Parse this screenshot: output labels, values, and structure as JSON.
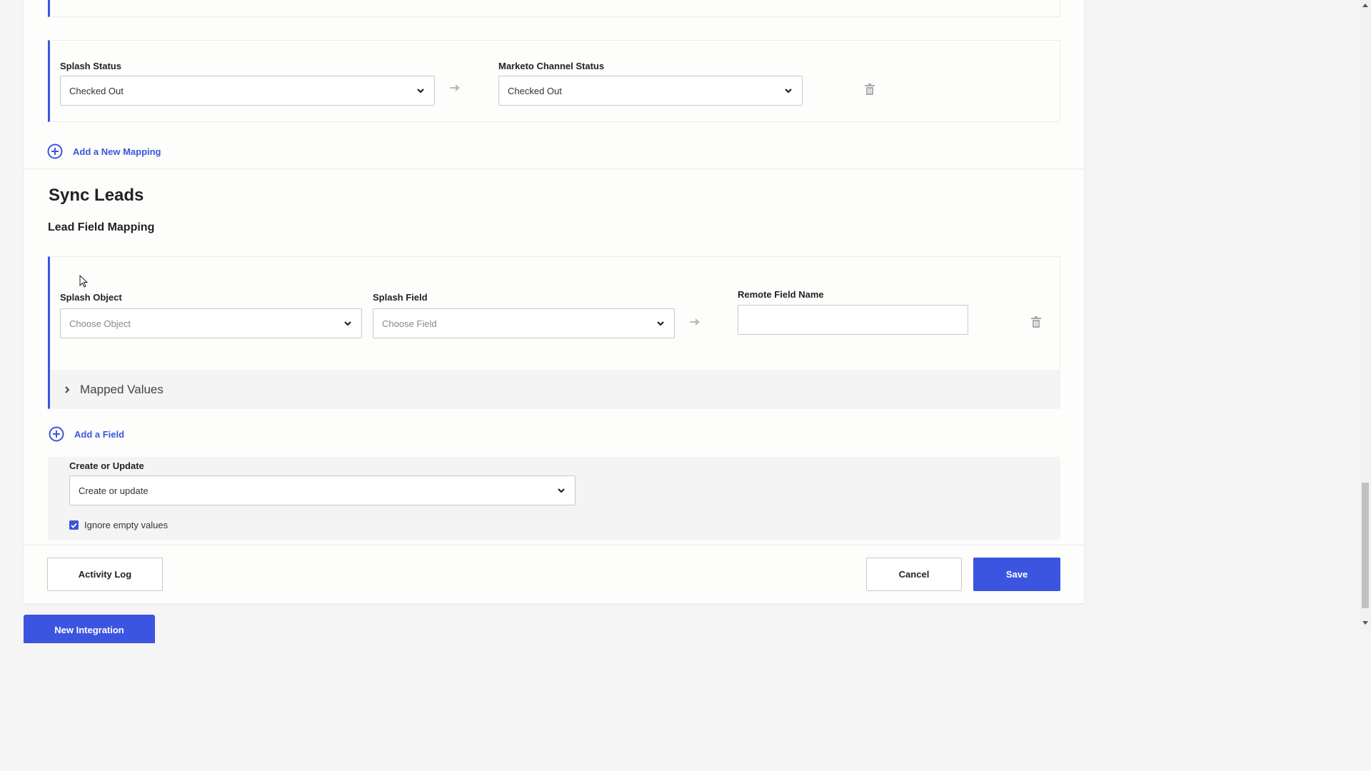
{
  "status_mapping": {
    "splash_label": "Splash Status",
    "splash_value": "Checked Out",
    "remote_label": "Marketo Channel Status",
    "remote_value": "Checked Out",
    "add_mapping_label": "Add a New Mapping"
  },
  "sync_leads": {
    "title": "Sync Leads",
    "subtitle": "Lead Field Mapping",
    "object_label": "Splash Object",
    "object_placeholder": "Choose Object",
    "field_label": "Splash Field",
    "field_placeholder": "Choose Field",
    "remote_label": "Remote Field Name",
    "remote_value": "",
    "mapped_values_label": "Mapped Values",
    "add_field_label": "Add a Field"
  },
  "options": {
    "create_update_label": "Create or Update",
    "create_update_value": "Create or update",
    "ignore_empty_label": "Ignore empty values",
    "ignore_empty_checked": true
  },
  "footer": {
    "activity_log_label": "Activity Log",
    "cancel_label": "Cancel",
    "save_label": "Save",
    "new_integration_label": "New Integration"
  },
  "colors": {
    "accent": "#3c55e0",
    "border": "#c9c9c9",
    "panel": "#f4f4f4"
  }
}
